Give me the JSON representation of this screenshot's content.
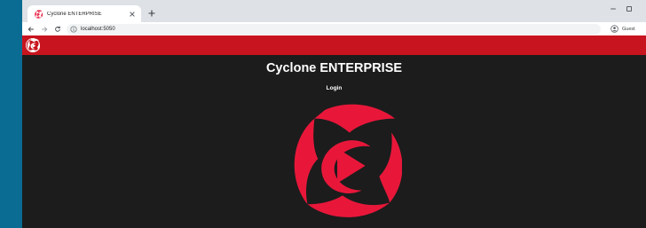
{
  "browser": {
    "tab_title": "Cyclone ENTERPRISE",
    "url": "localhost:5050",
    "profile_label": "Guest"
  },
  "app": {
    "heading": "Cyclone ENTERPRISE",
    "subheading": "Login",
    "brand_color": "#c8141e",
    "logo_color": "#e8173a",
    "background_color": "#1c1c1c"
  },
  "icons": {
    "tab_favicon": "cyclone-logo-icon",
    "tab_close": "close-icon",
    "new_tab": "plus-icon",
    "back": "arrow-left-icon",
    "forward": "arrow-right-icon",
    "reload": "reload-icon",
    "site_info": "info-icon",
    "profile": "account-circle-icon",
    "minimize": "minimize-icon",
    "maximize": "maximize-icon",
    "app_logo": "cyclone-logo-icon"
  }
}
